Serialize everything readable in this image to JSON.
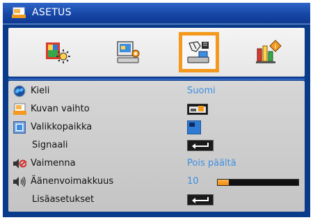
{
  "menu": {
    "title": "ASETUS",
    "accent_color": "#f39a1e",
    "title_color": "#1646a6"
  },
  "tabs": [
    {
      "id": "image",
      "icon": "image-settings-icon",
      "active": false
    },
    {
      "id": "display",
      "icon": "display-settings-icon",
      "active": false
    },
    {
      "id": "setup",
      "icon": "setup-icon",
      "active": true
    },
    {
      "id": "options",
      "icon": "options-icon",
      "active": false
    }
  ],
  "rows": [
    {
      "label": "Kieli",
      "icon": "globe-icon",
      "value": "Suomi"
    },
    {
      "label": "Kuvan vaihto",
      "icon": "projection-icon",
      "value_icon": "projection-mode-icon"
    },
    {
      "label": "Valikkopaikka",
      "icon": "menu-location-icon",
      "value_icon": "menu-location-selected-icon"
    },
    {
      "label": "Signaali",
      "value_icon": "enter-icon"
    },
    {
      "label": "Vaimenna",
      "icon": "mute-icon",
      "value": "Pois päältä"
    },
    {
      "label": "Äänenvoimakkuus",
      "icon": "volume-icon",
      "value": "10",
      "level_fraction": 0.14
    },
    {
      "label": "Lisäasetukset",
      "value_icon": "enter-icon"
    }
  ]
}
